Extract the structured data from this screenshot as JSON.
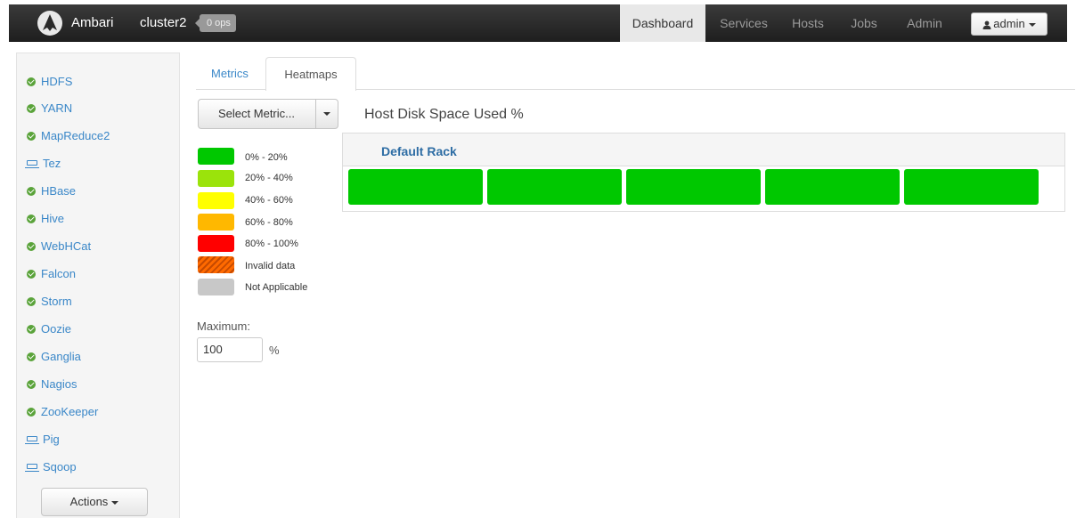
{
  "navbar": {
    "brand": "Ambari",
    "cluster": "cluster2",
    "ops_badge": "0 ops",
    "tabs": [
      "Dashboard",
      "Services",
      "Hosts",
      "Jobs",
      "Admin"
    ],
    "active_tab": "Dashboard",
    "user_menu": "admin",
    "user_icon": "user-icon"
  },
  "sidebar": {
    "services": [
      {
        "name": "HDFS",
        "icon": "check-circle-icon"
      },
      {
        "name": "YARN",
        "icon": "check-circle-icon"
      },
      {
        "name": "MapReduce2",
        "icon": "check-circle-icon"
      },
      {
        "name": "Tez",
        "icon": "laptop-icon"
      },
      {
        "name": "HBase",
        "icon": "check-circle-icon"
      },
      {
        "name": "Hive",
        "icon": "check-circle-icon"
      },
      {
        "name": "WebHCat",
        "icon": "check-circle-icon"
      },
      {
        "name": "Falcon",
        "icon": "check-circle-icon"
      },
      {
        "name": "Storm",
        "icon": "check-circle-icon"
      },
      {
        "name": "Oozie",
        "icon": "check-circle-icon"
      },
      {
        "name": "Ganglia",
        "icon": "check-circle-icon"
      },
      {
        "name": "Nagios",
        "icon": "check-circle-icon"
      },
      {
        "name": "ZooKeeper",
        "icon": "check-circle-icon"
      },
      {
        "name": "Pig",
        "icon": "laptop-icon"
      },
      {
        "name": "Sqoop",
        "icon": "laptop-icon"
      }
    ],
    "actions_label": "Actions"
  },
  "main": {
    "tabs": [
      "Metrics",
      "Heatmaps"
    ],
    "active_tab": "Heatmaps",
    "select_metric_label": "Select Metric...",
    "heatmap_title": "Host Disk Space Used %",
    "legend": [
      {
        "label": "0% - 20%",
        "color": "#00c800"
      },
      {
        "label": "20% - 40%",
        "color": "#9be30b"
      },
      {
        "label": "40% - 60%",
        "color": "#ffff00"
      },
      {
        "label": "60% - 80%",
        "color": "#ffb800"
      },
      {
        "label": "80% - 100%",
        "color": "#ff0000"
      },
      {
        "label": "Invalid data",
        "color": "#ff6a00"
      },
      {
        "label": "Not Applicable",
        "color": "#c8c8c8"
      }
    ],
    "maximum_label": "Maximum:",
    "maximum_value": "100",
    "maximum_unit": "%",
    "rack": {
      "name": "Default Rack",
      "host_color": "#00c800",
      "host_count": 5
    }
  }
}
